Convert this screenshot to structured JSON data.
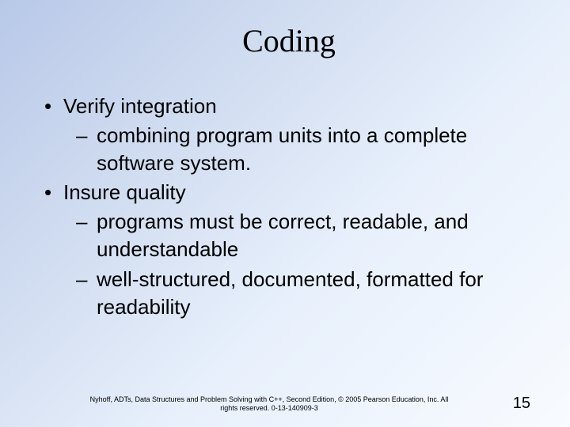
{
  "title": "Coding",
  "bullets": [
    {
      "text": "Verify integration",
      "subs": [
        "combining program units into a complete software system."
      ]
    },
    {
      "text": "Insure quality",
      "subs": [
        "programs must be  correct,  readable, and understandable",
        "well-structured, documented, formatted for readability"
      ]
    }
  ],
  "footer": {
    "copyright": "Nyhoff, ADTs, Data Structures and Problem Solving with C++, Second Edition, © 2005 Pearson Education, Inc. All rights reserved. 0-13-140909-3",
    "page": "15"
  }
}
